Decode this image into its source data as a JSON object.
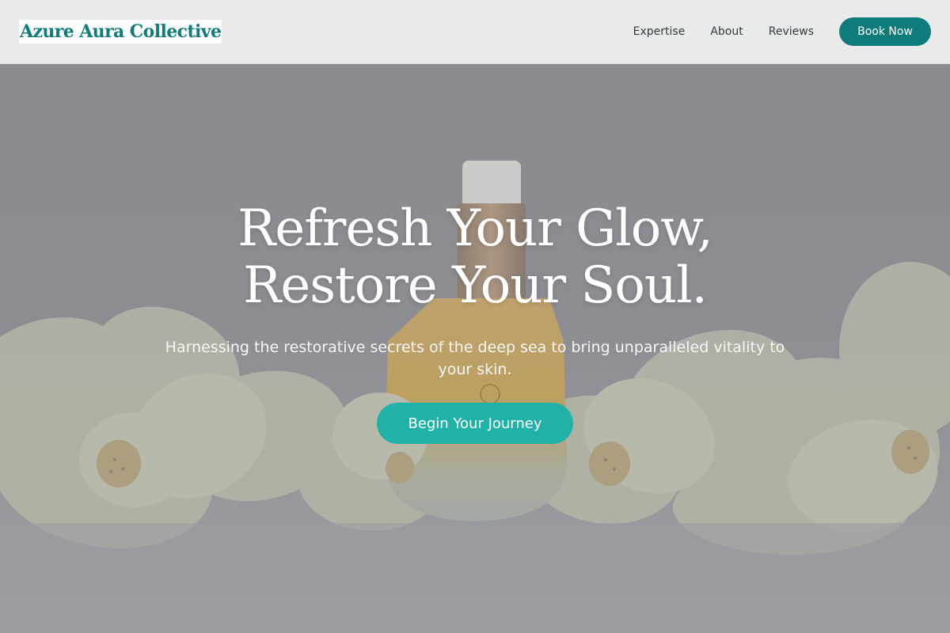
{
  "header": {
    "logo": "Azure Aura Collective",
    "nav": [
      "Expertise",
      "About",
      "Reviews"
    ],
    "cta": "Book Now"
  },
  "hero": {
    "title_line1": "Refresh Your Glow,",
    "title_line2": "Restore Your Soul.",
    "subtitle": "Harnessing the restorative secrets of the deep sea to bring unparalleled vitality to your skin.",
    "cta": "Begin Your Journey",
    "image_alt": "Serum bottle among white orchids"
  },
  "colors": {
    "brand": "#0f7c7b",
    "accent": "#20b2a9",
    "header_bg": "#e9eaea"
  }
}
